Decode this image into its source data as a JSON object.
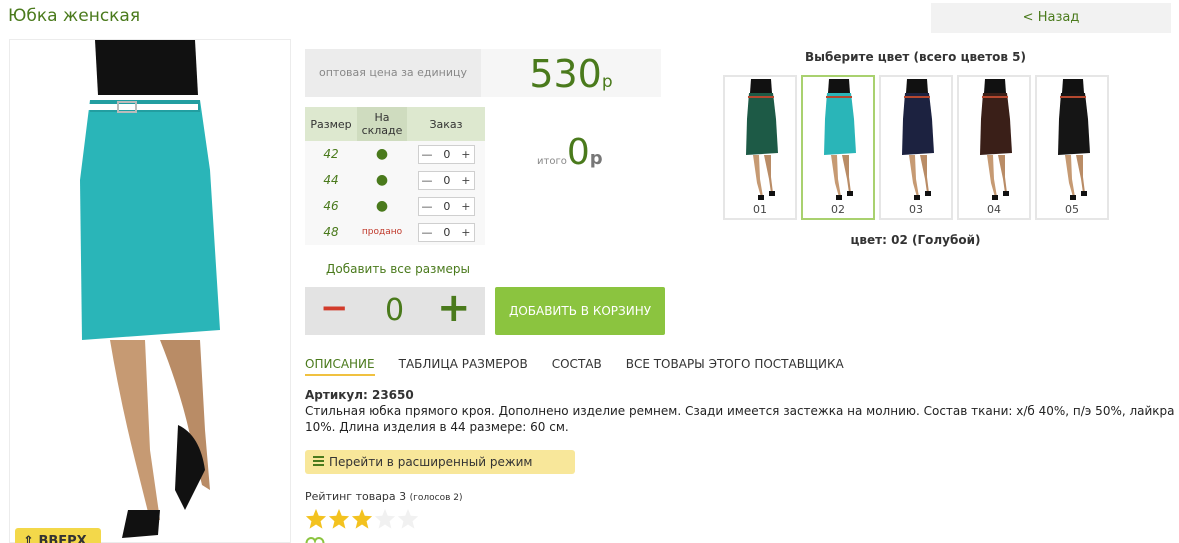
{
  "header": {
    "title": "Юбка женская",
    "back_label": "< Назад"
  },
  "price": {
    "label": "оптовая цена за единицу",
    "value": "530",
    "currency": "р"
  },
  "size_table": {
    "headers": [
      "Размер",
      "На складе",
      "Заказ"
    ],
    "rows": [
      {
        "size": "42",
        "stock": "●",
        "qty": "0"
      },
      {
        "size": "44",
        "stock": "●",
        "qty": "0"
      },
      {
        "size": "46",
        "stock": "●",
        "qty": "0"
      },
      {
        "size": "48",
        "stock": "продано",
        "qty": "0"
      }
    ]
  },
  "total": {
    "label": "итого",
    "value": "0",
    "currency": "р"
  },
  "add_all_sizes": "Добавить все размеры",
  "quantity": {
    "minus": "−",
    "value": "0",
    "plus": "+"
  },
  "add_to_cart": "ДОБАВИТЬ В КОРЗИНУ",
  "tabs": [
    "ОПИСАНИЕ",
    "ТАБЛИЦА РАЗМЕРОВ",
    "СОСТАВ",
    "ВСЕ ТОВАРЫ ЭТОГО ПОСТАВЩИКА"
  ],
  "description": {
    "sku": "Артикул: 23650",
    "text": "Стильная юбка прямого кроя. Дополнено изделие ремнем. Сзади имеется застежка на молнию. Состав ткани: х/б 40%, п/э 50%, лайкра 10%. Длина изделия в 44 размере: 60 см."
  },
  "advanced_mode": "Перейти в расширенный режим",
  "rating": {
    "text": "Рейтинг товара 3",
    "votes": "(голосов 2)",
    "value": 3,
    "max": 5
  },
  "up_button": "ВВЕРХ",
  "colors": {
    "title": "Выберите цвет (всего цветов 5)",
    "items": [
      {
        "label": "01",
        "color": "#1d5a46"
      },
      {
        "label": "02",
        "color": "#2ab5b8"
      },
      {
        "label": "03",
        "color": "#1c2240"
      },
      {
        "label": "04",
        "color": "#3a1f18"
      },
      {
        "label": "05",
        "color": "#151515"
      }
    ],
    "selected_index": 1,
    "selected_text": "цвет: 02 (Голубой)"
  },
  "theme": {
    "accent": "#4a7a1c",
    "button_green": "#8bc43f",
    "star": "#f3c21f"
  }
}
